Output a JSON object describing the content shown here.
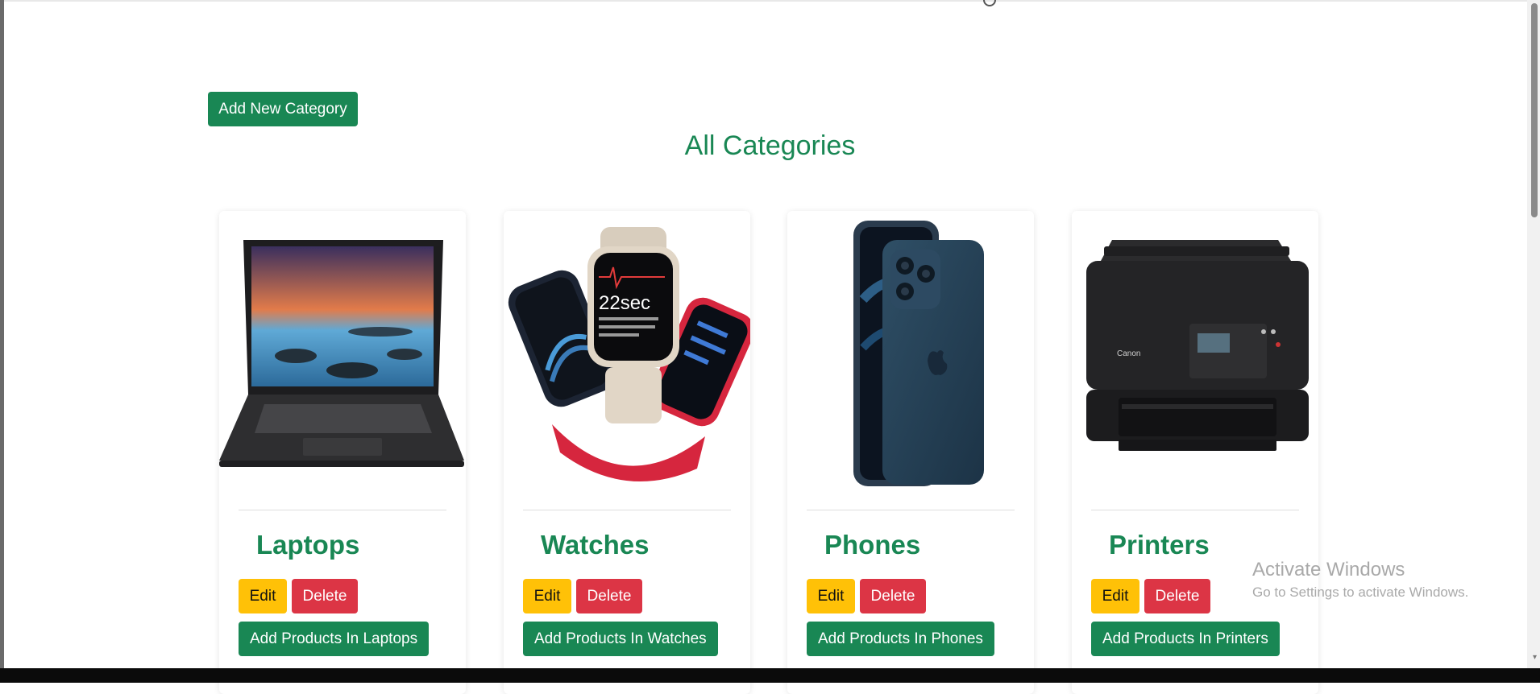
{
  "toolbar": {
    "add_category_label": "Add New Category"
  },
  "page": {
    "title": "All Categories"
  },
  "cards": [
    {
      "title": "Laptops",
      "edit_label": "Edit",
      "delete_label": "Delete",
      "add_products_label": "Add Products In Laptops",
      "image_icon": "laptop-image"
    },
    {
      "title": "Watches",
      "edit_label": "Edit",
      "delete_label": "Delete",
      "add_products_label": "Add Products In Watches",
      "image_icon": "smartwatch-image"
    },
    {
      "title": "Phones",
      "edit_label": "Edit",
      "delete_label": "Delete",
      "add_products_label": "Add Products In Phones",
      "image_icon": "phone-image"
    },
    {
      "title": "Printers",
      "edit_label": "Edit",
      "delete_label": "Delete",
      "add_products_label": "Add Products In Printers",
      "image_icon": "printer-image"
    }
  ],
  "watermark": {
    "title": "Activate Windows",
    "subtitle": "Go to Settings to activate Windows."
  },
  "colors": {
    "primary_green": "#198754",
    "warning_yellow": "#ffc107",
    "danger_red": "#dc3545"
  }
}
